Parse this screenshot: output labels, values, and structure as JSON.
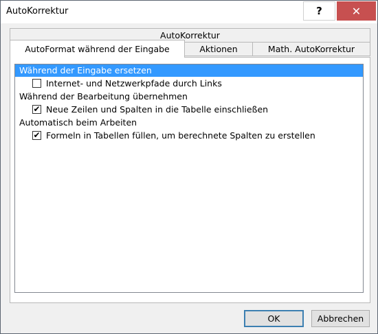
{
  "window": {
    "title": "AutoKorrektur",
    "help_label": "?",
    "close_label": "✕"
  },
  "tabs": {
    "back_row": [
      "AutoKorrektur"
    ],
    "front_row": [
      "AutoFormat während der Eingabe",
      "Aktionen",
      "Math. AutoKorrektur"
    ],
    "active": "AutoFormat während der Eingabe"
  },
  "list": {
    "items": [
      {
        "type": "header",
        "label": "Während der Eingabe ersetzen",
        "selected": true
      },
      {
        "type": "option",
        "label": "Internet- und Netzwerkpfade durch Links",
        "checked": false
      },
      {
        "type": "header",
        "label": "Während der Bearbeitung übernehmen",
        "selected": false
      },
      {
        "type": "option",
        "label": "Neue Zeilen und Spalten in die Tabelle einschließen",
        "checked": true
      },
      {
        "type": "header",
        "label": "Automatisch beim Arbeiten",
        "selected": false
      },
      {
        "type": "option",
        "label": "Formeln in Tabellen füllen, um berechnete Spalten zu erstellen",
        "checked": true
      }
    ]
  },
  "buttons": {
    "ok": "OK",
    "cancel": "Abbrechen"
  },
  "colors": {
    "selection": "#3399ff",
    "close_button": "#c75050"
  }
}
